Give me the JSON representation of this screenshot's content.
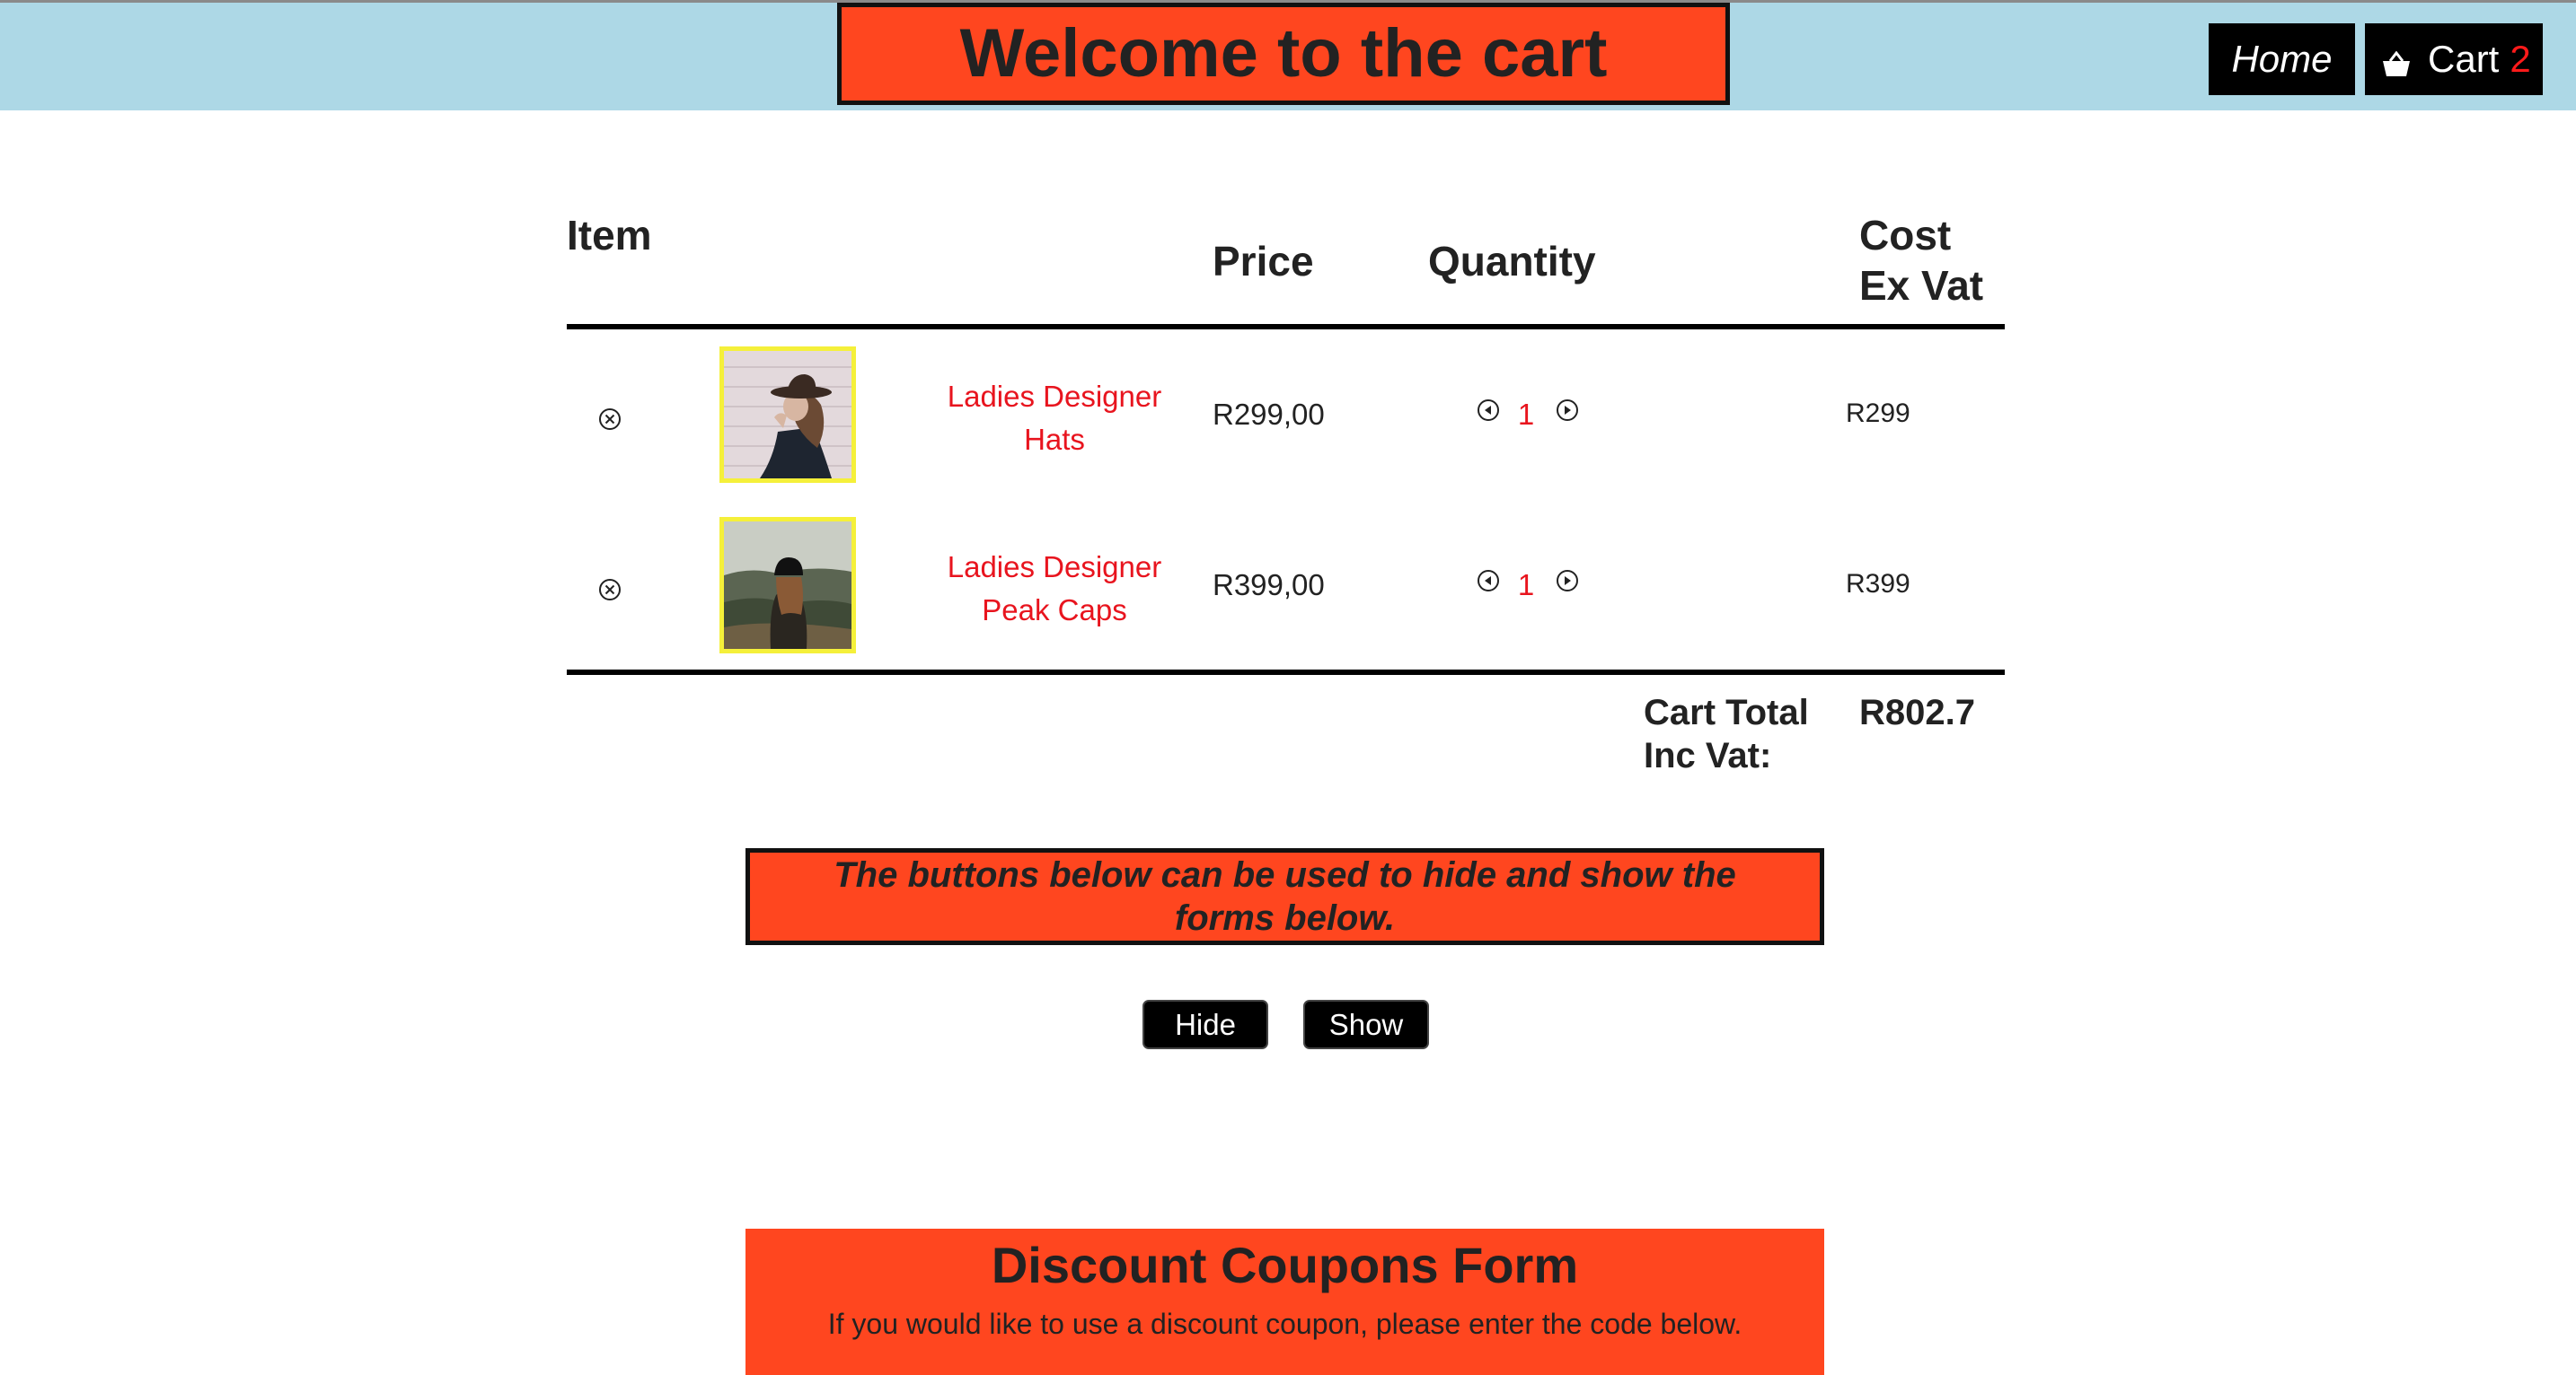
{
  "header": {
    "title": "Welcome to the cart",
    "nav": {
      "home_label": "Home",
      "cart_label": "Cart",
      "cart_count": "2"
    }
  },
  "table": {
    "headers": {
      "item": "Item",
      "price": "Price",
      "quantity": "Quantity",
      "cost_line1": "Cost",
      "cost_line2": "Ex Vat"
    },
    "rows": [
      {
        "name_line1": "Ladies Designer",
        "name_line2": "Hats",
        "price": "R299,00",
        "quantity": "1",
        "cost": "R299",
        "image": "woman-in-hat-photo"
      },
      {
        "name_line1": "Ladies Designer",
        "name_line2": "Peak Caps",
        "price": "R399,00",
        "quantity": "1",
        "cost": "R399",
        "image": "woman-in-cap-photo"
      }
    ],
    "total": {
      "label_line1": "Cart Total",
      "label_line2": "Inc Vat:",
      "value": "R802.7"
    }
  },
  "notice": {
    "text": "The buttons below can be used to hide and show the forms below."
  },
  "buttons": {
    "hide": "Hide",
    "show": "Show"
  },
  "coupon_form": {
    "title": "Discount Coupons Form",
    "description": "If you would like to use a discount coupon, please enter the code below."
  },
  "colors": {
    "accent": "#ff461f",
    "header_bg": "#add8e6",
    "item_link": "#e8141e",
    "thumb_border": "#f5f03a"
  }
}
